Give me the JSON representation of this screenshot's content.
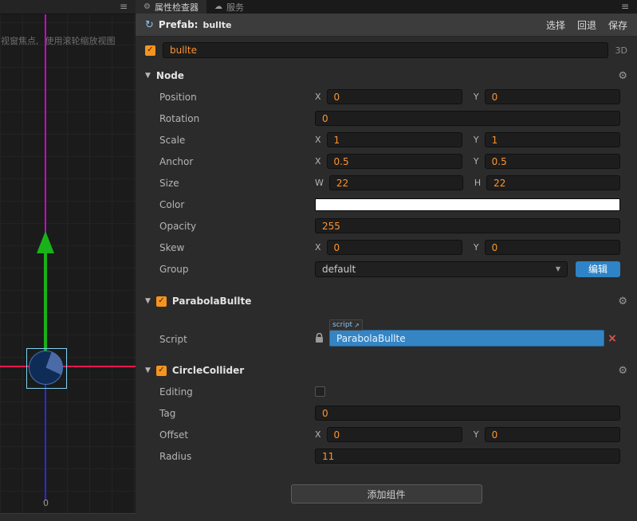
{
  "icons": {
    "menu": "≡",
    "gear": "⚙",
    "caret_down": "▼",
    "check": "✓",
    "sync": "↻",
    "service": "☁",
    "close": "×",
    "external": "↗"
  },
  "colors": {
    "accent_orange": "#fd942e",
    "accent_blue": "#2e84c6",
    "script_selected_blue": "#3585c5",
    "checkbox_orange": "#f7941d",
    "gizmo_green": "#19b219",
    "gizmo_magenta": "#cf00cf",
    "gizmo_red": "#e8174e",
    "gizmo_blue": "#2a2ae0",
    "color_value": "#ffffff"
  },
  "scene": {
    "hint_left": "视窗焦点,",
    "hint_right": "使用滚轮缩放视图",
    "origin": "0"
  },
  "tabs": {
    "inspector": "属性检查器",
    "service": "服务"
  },
  "prefab_bar": {
    "label": "Prefab:",
    "name": "bullte",
    "select": "选择",
    "revert": "回退",
    "save": "保存"
  },
  "node_row": {
    "name": "bullte",
    "mode": "3D"
  },
  "node_section": {
    "title": "Node",
    "position": {
      "label": "Position",
      "x_label": "X",
      "x": "0",
      "y_label": "Y",
      "y": "0"
    },
    "rotation": {
      "label": "Rotation",
      "value": "0"
    },
    "scale": {
      "label": "Scale",
      "x_label": "X",
      "x": "1",
      "y_label": "Y",
      "y": "1"
    },
    "anchor": {
      "label": "Anchor",
      "x_label": "X",
      "x": "0.5",
      "y_label": "Y",
      "y": "0.5"
    },
    "size": {
      "label": "Size",
      "w_label": "W",
      "w": "22",
      "h_label": "H",
      "h": "22"
    },
    "color": {
      "label": "Color"
    },
    "opacity": {
      "label": "Opacity",
      "value": "255"
    },
    "skew": {
      "label": "Skew",
      "x_label": "X",
      "x": "0",
      "y_label": "Y",
      "y": "0"
    },
    "group": {
      "label": "Group",
      "value": "default",
      "edit_button": "编辑"
    }
  },
  "parabola_section": {
    "title": "ParabolaBullte",
    "script": {
      "label": "Script",
      "badge": "script",
      "value": "ParabolaBullte"
    }
  },
  "collider_section": {
    "title": "CircleCollider",
    "editing": {
      "label": "Editing"
    },
    "tag": {
      "label": "Tag",
      "value": "0"
    },
    "offset": {
      "label": "Offset",
      "x_label": "X",
      "x": "0",
      "y_label": "Y",
      "y": "0"
    },
    "radius": {
      "label": "Radius",
      "value": "11"
    }
  },
  "footer": {
    "add_component": "添加组件"
  }
}
